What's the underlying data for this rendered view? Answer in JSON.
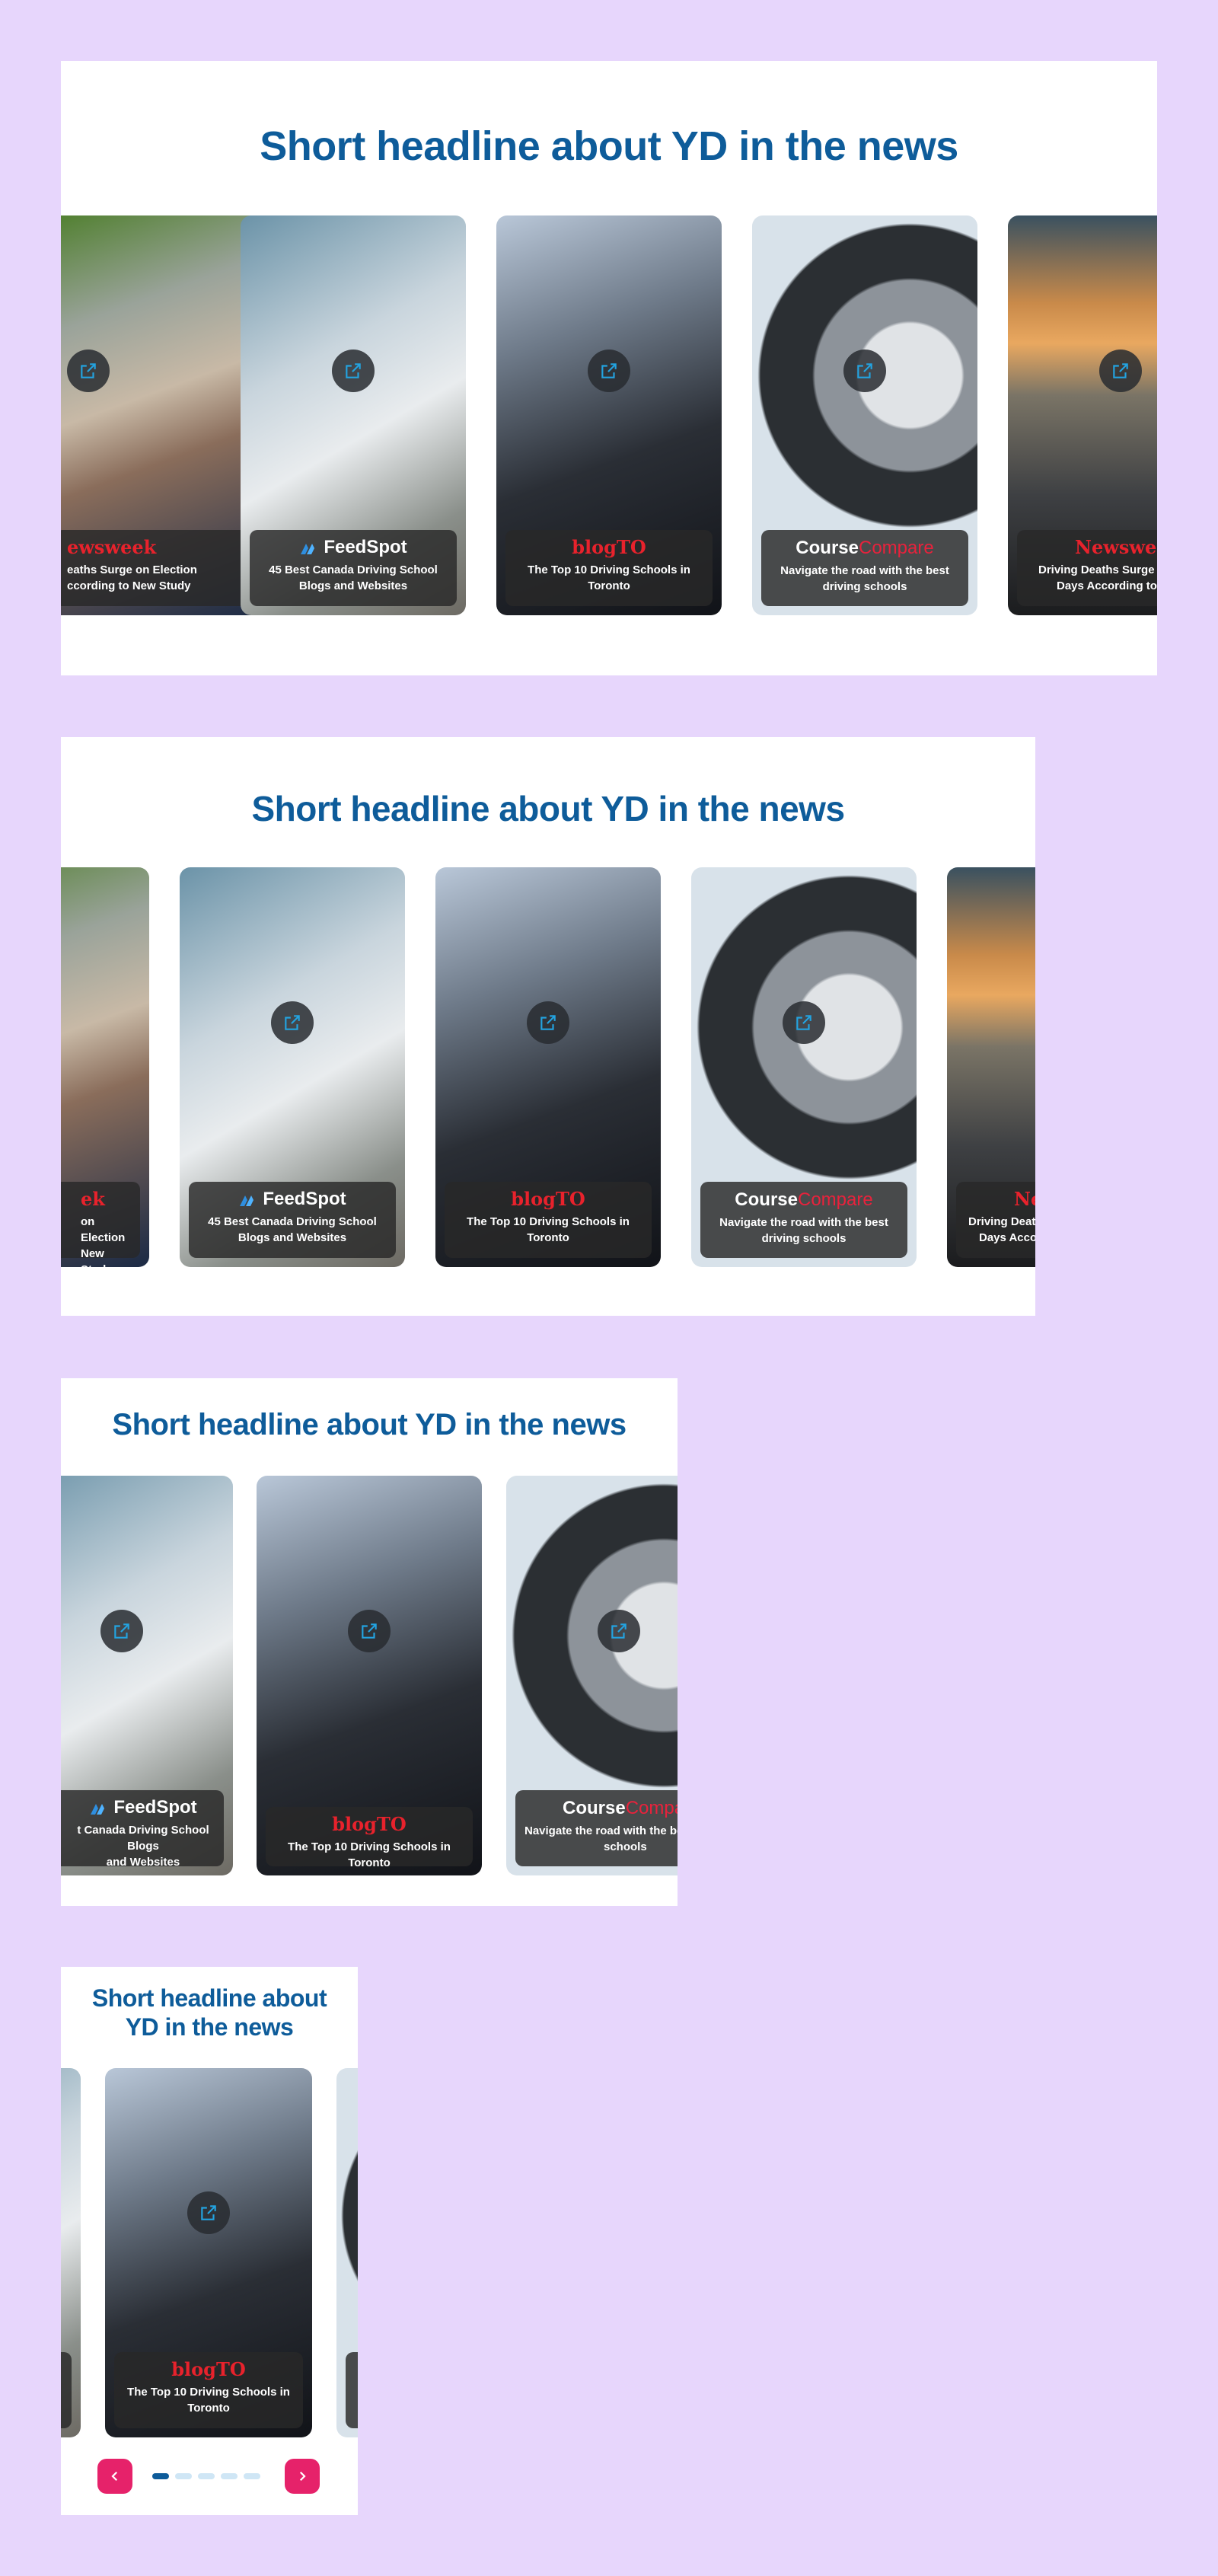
{
  "headline": "Short headline about YD in the news",
  "headline_short": {
    "line1": "Short headline about",
    "line2": "YD in the news"
  },
  "icons": {
    "external_link": "external-link-icon",
    "feedspot_mark": "feedspot-logo-icon",
    "prev": "chevron-left-icon",
    "next": "chevron-right-icon"
  },
  "colors": {
    "background": "#e7d6fc",
    "headline": "#0e5c9a",
    "accent_red": "#e8222c",
    "nav_button": "#e6226a",
    "dot_active": "#0e5c9a",
    "dot_inactive": "#cfe6f5"
  },
  "articles": [
    {
      "source": "Newsweek",
      "title": "Driving Deaths Surge on Election Days According to New Study"
    },
    {
      "source": "FeedSpot",
      "title": "45 Best Canada Driving School Blogs and Websites"
    },
    {
      "source": "blogTO",
      "title": "The Top 10 Driving Schools in Toronto"
    },
    {
      "source_part1": "Course",
      "source_part2": "Compare",
      "title": "Navigate the road with the best driving schools"
    },
    {
      "source": "Newsweek",
      "title": "Driving Deaths Surge on Election Days According to New Study"
    }
  ],
  "fragments": {
    "p1_newsweek_brand": "ewsweek",
    "p1_newsweek_line1": "eaths Surge on Election",
    "p1_newsweek_line2": "ccording to New Study",
    "p1_right_brand": "Newswee",
    "p1_right_line1": "Driving Deaths Surge o",
    "p1_right_line2": "Days According to Ne",
    "p2_left_brand": "ek",
    "p2_left_line1": "on Election",
    "p2_left_line2": "New Study",
    "p2_right_brand": "Ne",
    "p2_right_line1": "Driving Deat",
    "p2_right_line2": "Days Acco",
    "p3_feedspot_line1": "t Canada Driving School Blogs",
    "p3_feedspot_line2": "and Websites",
    "p3_cc_part2": "Compare",
    "p3_cc_line1": "Navigate the road with the best",
    "p3_cc_line2": "schools"
  },
  "carousel": {
    "total_slides": 5,
    "current_slide": 1
  }
}
